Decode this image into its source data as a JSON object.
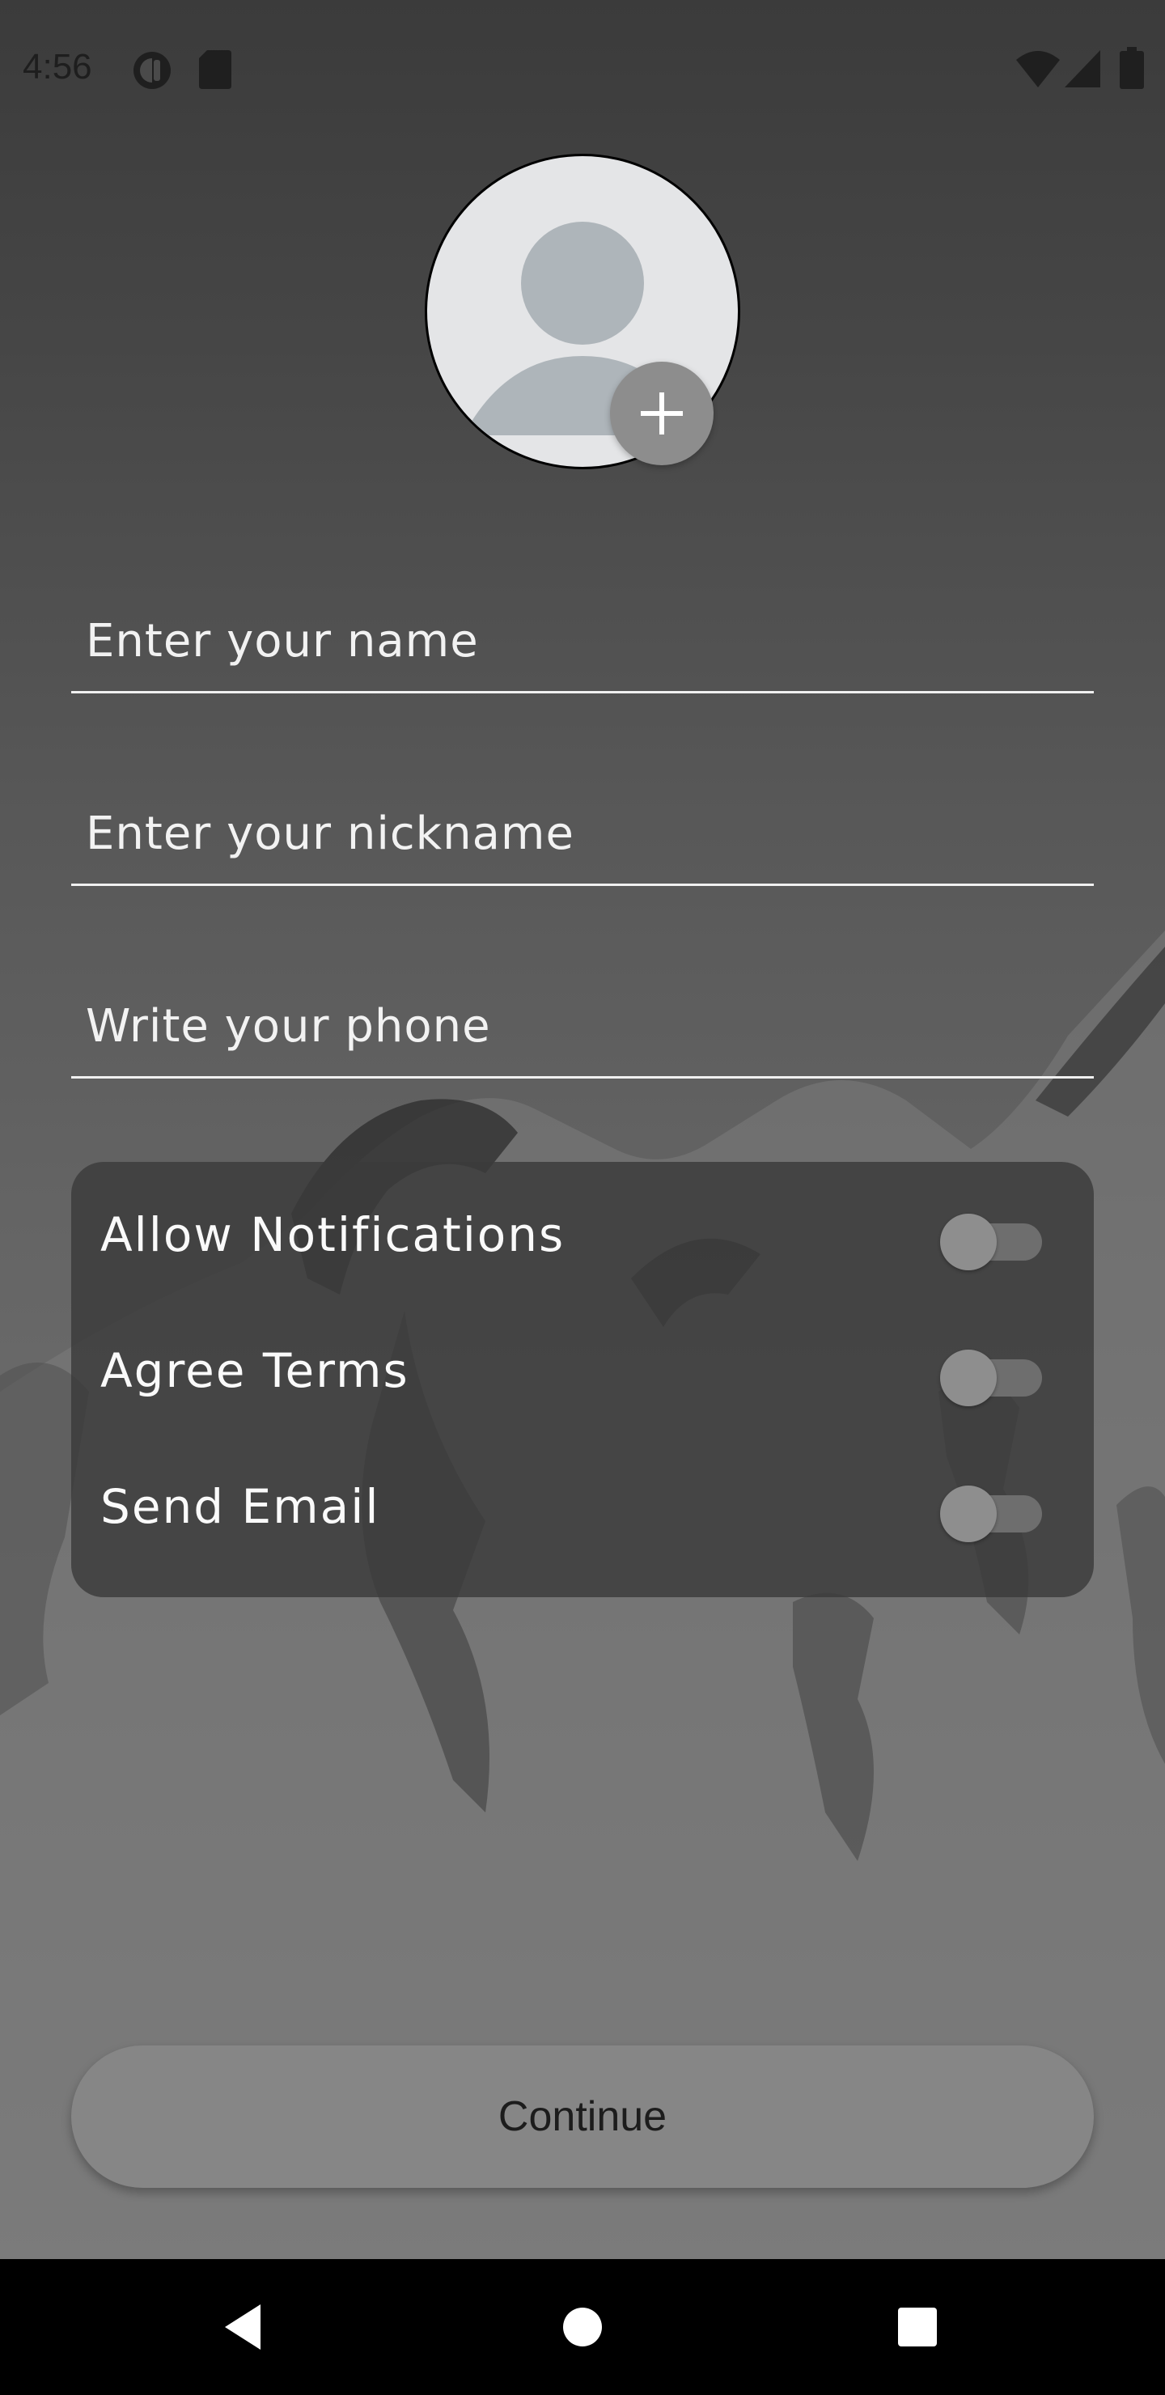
{
  "status_bar": {
    "time": "4:56",
    "icons": [
      "cloud-icon",
      "sd-card-icon",
      "wifi-icon",
      "signal-icon",
      "battery-icon"
    ]
  },
  "avatar": {
    "icon": "person-placeholder-icon",
    "add_icon": "plus-icon"
  },
  "form": {
    "name_placeholder": "Enter your name",
    "nickname_placeholder": "Enter your nickname",
    "phone_placeholder": "Write your phone"
  },
  "settings": {
    "items": [
      {
        "label": "Allow Notifications",
        "enabled": false
      },
      {
        "label": "Agree Terms",
        "enabled": false
      },
      {
        "label": "Send Email",
        "enabled": false
      }
    ]
  },
  "continue_label": "Continue",
  "nav": {
    "icons": [
      "back-icon",
      "home-icon",
      "recents-icon"
    ]
  },
  "colors": {
    "card": "#3a3a3a",
    "button": "#868686",
    "underline": "#f0f0f0"
  }
}
